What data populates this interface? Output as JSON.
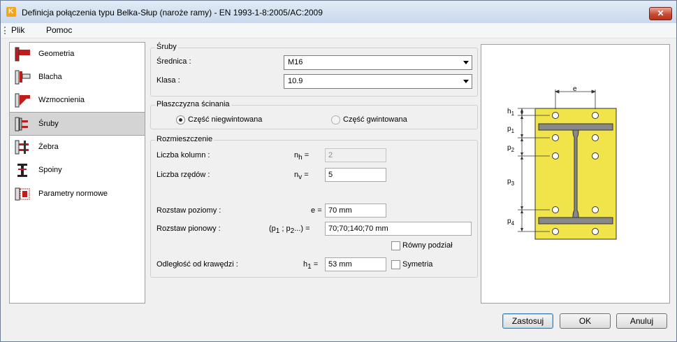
{
  "window": {
    "title": "Definicja połączenia typu Belka-Słup (naroże ramy) - EN 1993-1-8:2005/AC:2009",
    "close_glyph": "✕",
    "app_icon_glyph": "K"
  },
  "menu": {
    "items": [
      "Plik",
      "Pomoc"
    ]
  },
  "sidebar": {
    "items": [
      {
        "label": "Geometria",
        "icon": "geometry-icon"
      },
      {
        "label": "Blacha",
        "icon": "plate-icon"
      },
      {
        "label": "Wzmocnienia",
        "icon": "stiffeners-icon"
      },
      {
        "label": "Śruby",
        "icon": "bolts-icon",
        "selected": true
      },
      {
        "label": "Żebra",
        "icon": "ribs-icon"
      },
      {
        "label": "Spoiny",
        "icon": "welds-icon"
      },
      {
        "label": "Parametry normowe",
        "icon": "code-params-icon"
      }
    ]
  },
  "bolts": {
    "group_title": "Śruby",
    "diameter_label": "Średnica  :",
    "diameter_value": "M16",
    "class_label": "Klasa  :",
    "class_value": "10.9"
  },
  "shear_plane": {
    "group_title": "Płaszczyzna ścinania",
    "option_unthreaded": "Część niegwintowana",
    "option_threaded": "Część gwintowana",
    "selected": "unthreaded"
  },
  "layout": {
    "group_title": "Rozmieszczenie",
    "columns_label": "Liczba kolumn :",
    "columns_sym": "n",
    "columns_sub": "h",
    "columns_value": "2",
    "rows_label": "Liczba rzędów :",
    "rows_sym": "n",
    "rows_sub": "v",
    "rows_value": "5",
    "hspacing_label": "Rozstaw poziomy :",
    "hspacing_sym": "e",
    "hspacing_value": "70 mm",
    "vspacing_label": "Rozstaw pionowy :",
    "vspacing_sym_open": "(p",
    "vspacing_sub1": "1",
    "vspacing_sep": " ; p",
    "vspacing_sub2": "2",
    "vspacing_sym_close": "...)",
    "vspacing_value": "70;70;140;70 mm",
    "equal_split_label": "Równy podział",
    "edge_label": "Odległość od krawędzi :",
    "edge_sym": "h",
    "edge_sub": "1",
    "edge_value": "53 mm",
    "symmetry_label": "Symetria",
    "eq": "="
  },
  "drawing": {
    "labels": {
      "e": "e",
      "h1": "h",
      "h1_sub": "1",
      "p1": "p",
      "p1_sub": "1",
      "p2": "p",
      "p2_sub": "2",
      "p3": "p",
      "p3_sub": "3",
      "p4": "p",
      "p4_sub": "4"
    },
    "colors": {
      "plate": "#f1e34a",
      "beam": "#888888"
    }
  },
  "buttons": {
    "apply": "Zastosuj",
    "ok": "OK",
    "cancel": "Anuluj"
  }
}
